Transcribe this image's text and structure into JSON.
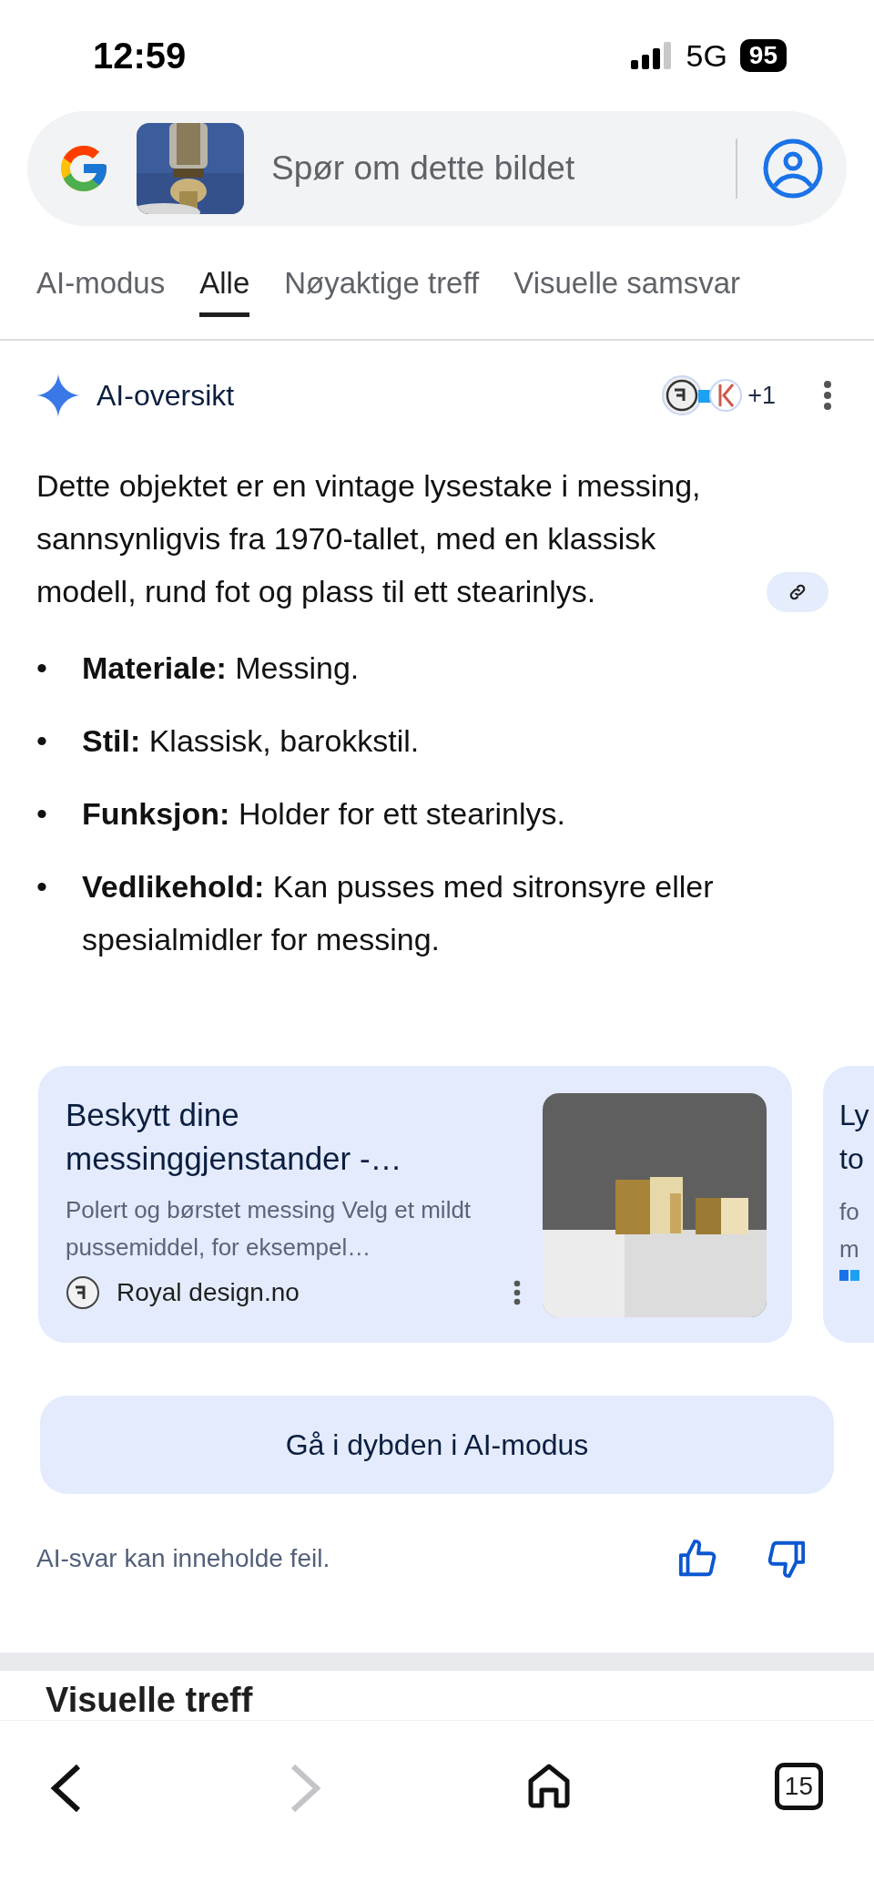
{
  "status_bar": {
    "time": "12:59",
    "network": "5G",
    "battery": "95"
  },
  "search": {
    "placeholder": "Spør om dette bildet"
  },
  "tabs": [
    {
      "label": "AI-modus",
      "selected": false
    },
    {
      "label": "Alle",
      "selected": true
    },
    {
      "label": "Nøyaktige treff",
      "selected": false
    },
    {
      "label": "Visuelle samsvar",
      "selected": false
    }
  ],
  "overview": {
    "title": "AI-oversikt",
    "sources_more": "+1",
    "summary": "Dette objektet er en vintage lysestake i messing, sannsynligvis fra 1970-tallet, med en klassisk modell, rund fot og plass til ett stearinlys.",
    "bullets": [
      {
        "marker": "•",
        "term": "Materiale:",
        "text": "Messing."
      },
      {
        "marker": "•",
        "term": "Stil:",
        "text": "Klassisk, barokkstil."
      },
      {
        "marker": "•",
        "term": "Funksjon:",
        "text": "Holder for ett stearinlys."
      },
      {
        "marker": "•",
        "term": "Vedlikehold:",
        "text": "Kan pusses med sitronsyre eller spesialmidler for messing."
      }
    ]
  },
  "cards": [
    {
      "title": "Beskytt dine messinggjenstander -…",
      "snippet": "Polert og børstet messing Velg et mildt pussemiddel, for eksempel…",
      "source": "Royal design.no"
    },
    {
      "title_lines": [
        "Ly",
        "to"
      ],
      "snippet_lines": [
        "fo",
        "m"
      ]
    }
  ],
  "deep_dive_button": "Gå i dybden i AI-modus",
  "disclaimer": "AI-svar kan inneholde feil.",
  "next_section": {
    "title": "Visuelle treff"
  },
  "bottom_nav": {
    "tab_count": "15"
  }
}
